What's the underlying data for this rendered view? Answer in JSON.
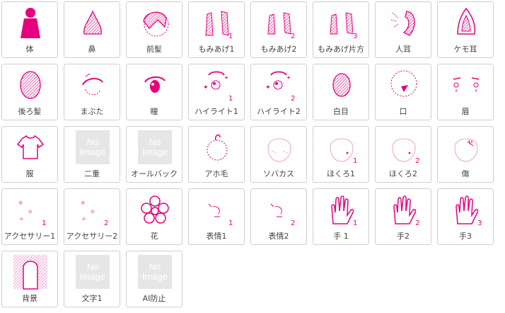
{
  "accent_color": "#e6007e",
  "placeholder_color": "#e6e6e6",
  "no_image_text": [
    "No",
    "Image"
  ],
  "tiles": [
    {
      "label": "体",
      "icon": "body-icon"
    },
    {
      "label": "鼻",
      "icon": "nose-icon"
    },
    {
      "label": "前髪",
      "icon": "bangs-icon"
    },
    {
      "label": "もみあげ1",
      "icon": "sideburns-1-icon"
    },
    {
      "label": "もみあげ2",
      "icon": "sideburns-2-icon"
    },
    {
      "label": "もみあげ片方",
      "icon": "sideburns-one-side-icon"
    },
    {
      "label": "人耳",
      "icon": "human-ear-icon"
    },
    {
      "label": "ケモ耳",
      "icon": "animal-ear-icon"
    },
    {
      "label": "後ろ髪",
      "icon": "back-hair-icon"
    },
    {
      "label": "まぶた",
      "icon": "eyelid-icon"
    },
    {
      "label": "瞳",
      "icon": "pupil-icon"
    },
    {
      "label": "ハイライト1",
      "icon": "highlight-1-icon"
    },
    {
      "label": "ハイライト2",
      "icon": "highlight-2-icon"
    },
    {
      "label": "白目",
      "icon": "eye-white-icon"
    },
    {
      "label": "口",
      "icon": "mouth-icon"
    },
    {
      "label": "眉",
      "icon": "eyebrow-icon"
    },
    {
      "label": "服",
      "icon": "clothes-icon"
    },
    {
      "label": "二重",
      "icon": "no-image-placeholder"
    },
    {
      "label": "オールバック",
      "icon": "no-image-placeholder"
    },
    {
      "label": "アホ毛",
      "icon": "ahoge-icon"
    },
    {
      "label": "ソバカス",
      "icon": "freckles-icon"
    },
    {
      "label": "ほくろ1",
      "icon": "mole-1-icon"
    },
    {
      "label": "ほくろ2",
      "icon": "mole-2-icon"
    },
    {
      "label": "傷",
      "icon": "scar-icon"
    },
    {
      "label": "アクセサリー1",
      "icon": "accessory-1-icon"
    },
    {
      "label": "アクセサリー2",
      "icon": "accessory-2-icon"
    },
    {
      "label": "花",
      "icon": "flower-icon"
    },
    {
      "label": "表情1",
      "icon": "expression-1-icon"
    },
    {
      "label": "表情2",
      "icon": "expression-2-icon"
    },
    {
      "label": "手 1",
      "icon": "hand-1-icon"
    },
    {
      "label": "手2",
      "icon": "hand-2-icon"
    },
    {
      "label": "手3",
      "icon": "hand-3-icon"
    },
    {
      "label": "背景",
      "icon": "background-icon"
    },
    {
      "label": "文字1",
      "icon": "no-image-placeholder"
    },
    {
      "label": "AI防止",
      "icon": "no-image-placeholder"
    }
  ],
  "digit_marks": {
    "sideburns-1-icon": "1",
    "sideburns-2-icon": "2",
    "sideburns-one-side-icon": "3",
    "highlight-1-icon": "1",
    "highlight-2-icon": "2",
    "mole-1-icon": "1",
    "mole-2-icon": "2",
    "accessory-1-icon": "1",
    "accessory-2-icon": "2",
    "expression-1-icon": "1",
    "expression-2-icon": "2",
    "hand-1-icon": "1",
    "hand-2-icon": "2",
    "hand-3-icon": "3"
  }
}
